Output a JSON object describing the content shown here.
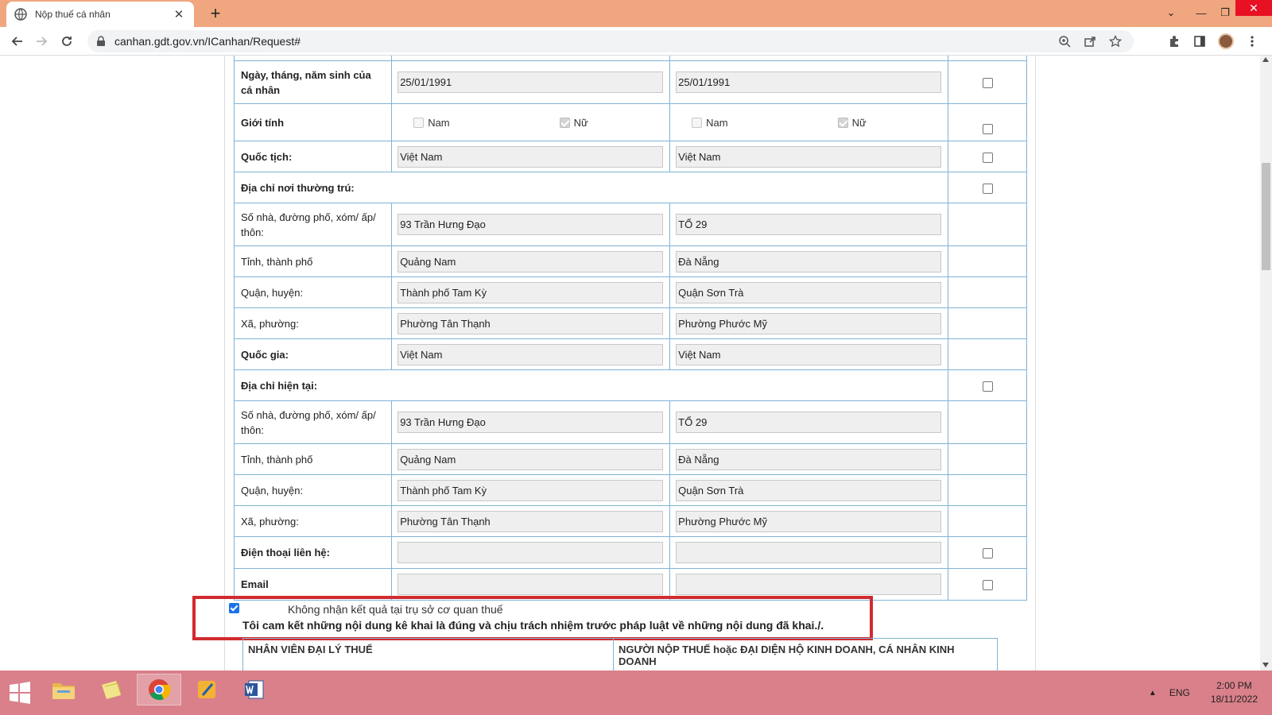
{
  "browser": {
    "tab_title": "Nộp thuế cá nhân",
    "url": "canhan.gdt.gov.vn/ICanhan/Request#",
    "new_tab_label": "+"
  },
  "form": {
    "rows": [
      {
        "type": "field",
        "label": "Ngày, tháng, năm sinh của cá nhân",
        "bold": true,
        "old": "25/01/1991",
        "new": "25/01/1991",
        "checkbox": true
      },
      {
        "type": "gender",
        "label": "Giới tính",
        "bold": true,
        "opt1": "Nam",
        "opt2": "Nữ",
        "checkbox": true
      },
      {
        "type": "field",
        "label": "Quốc tịch:",
        "bold": true,
        "old": "Việt Nam",
        "new": "Việt Nam",
        "checkbox": true
      },
      {
        "type": "section",
        "label": "Địa chỉ nơi thường trú:",
        "checkbox": true
      },
      {
        "type": "field",
        "label": "Số nhà, đường phố, xóm/ ấp/ thôn:",
        "bold": false,
        "old": "93 Trần Hưng Đạo",
        "new": "TỔ 29",
        "checkbox": false
      },
      {
        "type": "field",
        "label": "Tỉnh, thành phố",
        "bold": false,
        "old": "Quảng Nam",
        "new": "Đà Nẵng",
        "checkbox": false
      },
      {
        "type": "field",
        "label": "Quận, huyện:",
        "bold": false,
        "old": "Thành phố Tam Kỳ",
        "new": "Quận Sơn Trà",
        "checkbox": false
      },
      {
        "type": "field",
        "label": "Xã, phường:",
        "bold": false,
        "old": "Phường Tân Thạnh",
        "new": "Phường Phước Mỹ",
        "checkbox": false
      },
      {
        "type": "field",
        "label": "Quốc gia:",
        "bold": true,
        "old": "Việt Nam",
        "new": "Việt Nam",
        "checkbox": false
      },
      {
        "type": "section",
        "label": "Địa chỉ hiện tại:",
        "checkbox": true
      },
      {
        "type": "field",
        "label": "Số nhà, đường phố, xóm/ ấp/ thôn:",
        "bold": false,
        "old": "93 Trần Hưng Đạo",
        "new": "TỔ 29",
        "checkbox": false
      },
      {
        "type": "field",
        "label": "Tỉnh, thành phố",
        "bold": false,
        "old": "Quảng Nam",
        "new": "Đà Nẵng",
        "checkbox": false
      },
      {
        "type": "field",
        "label": "Quận, huyện:",
        "bold": false,
        "old": "Thành phố Tam Kỳ",
        "new": "Quận Sơn Trà",
        "checkbox": false
      },
      {
        "type": "field",
        "label": "Xã, phường:",
        "bold": false,
        "old": "Phường Tân Thạnh",
        "new": "Phường Phước Mỹ",
        "checkbox": false
      },
      {
        "type": "field",
        "label": "Điện thoại liên hệ:",
        "bold": true,
        "old": "",
        "new": "",
        "checkbox": true
      },
      {
        "type": "field",
        "label": "Email",
        "bold": true,
        "old": "",
        "new": "",
        "checkbox": true
      }
    ]
  },
  "commitment": {
    "no_pickup_label": "Không nhận kết quả tại trụ sở cơ quan thuế",
    "pledge": "Tôi cam kết những nội dung kê khai là đúng và chịu trách nhiệm trước pháp luật về những nội dung đã khai./."
  },
  "signatures": {
    "agent_label": "NHÂN VIÊN ĐẠI LÝ THUẾ",
    "taxpayer_label": "NGƯỜI NỘP THUẾ hoặc ĐẠI DIỆN HỘ KINH DOANH, CÁ NHÂN KINH DOANH"
  },
  "taskbar": {
    "language": "ENG",
    "time": "2:00 PM",
    "date": "18/11/2022"
  },
  "colors": {
    "tab_strip": "#f0a77f",
    "table_border": "#7fb3d5",
    "highlight_box": "#d12b2f",
    "taskbar": "#d9808a"
  }
}
